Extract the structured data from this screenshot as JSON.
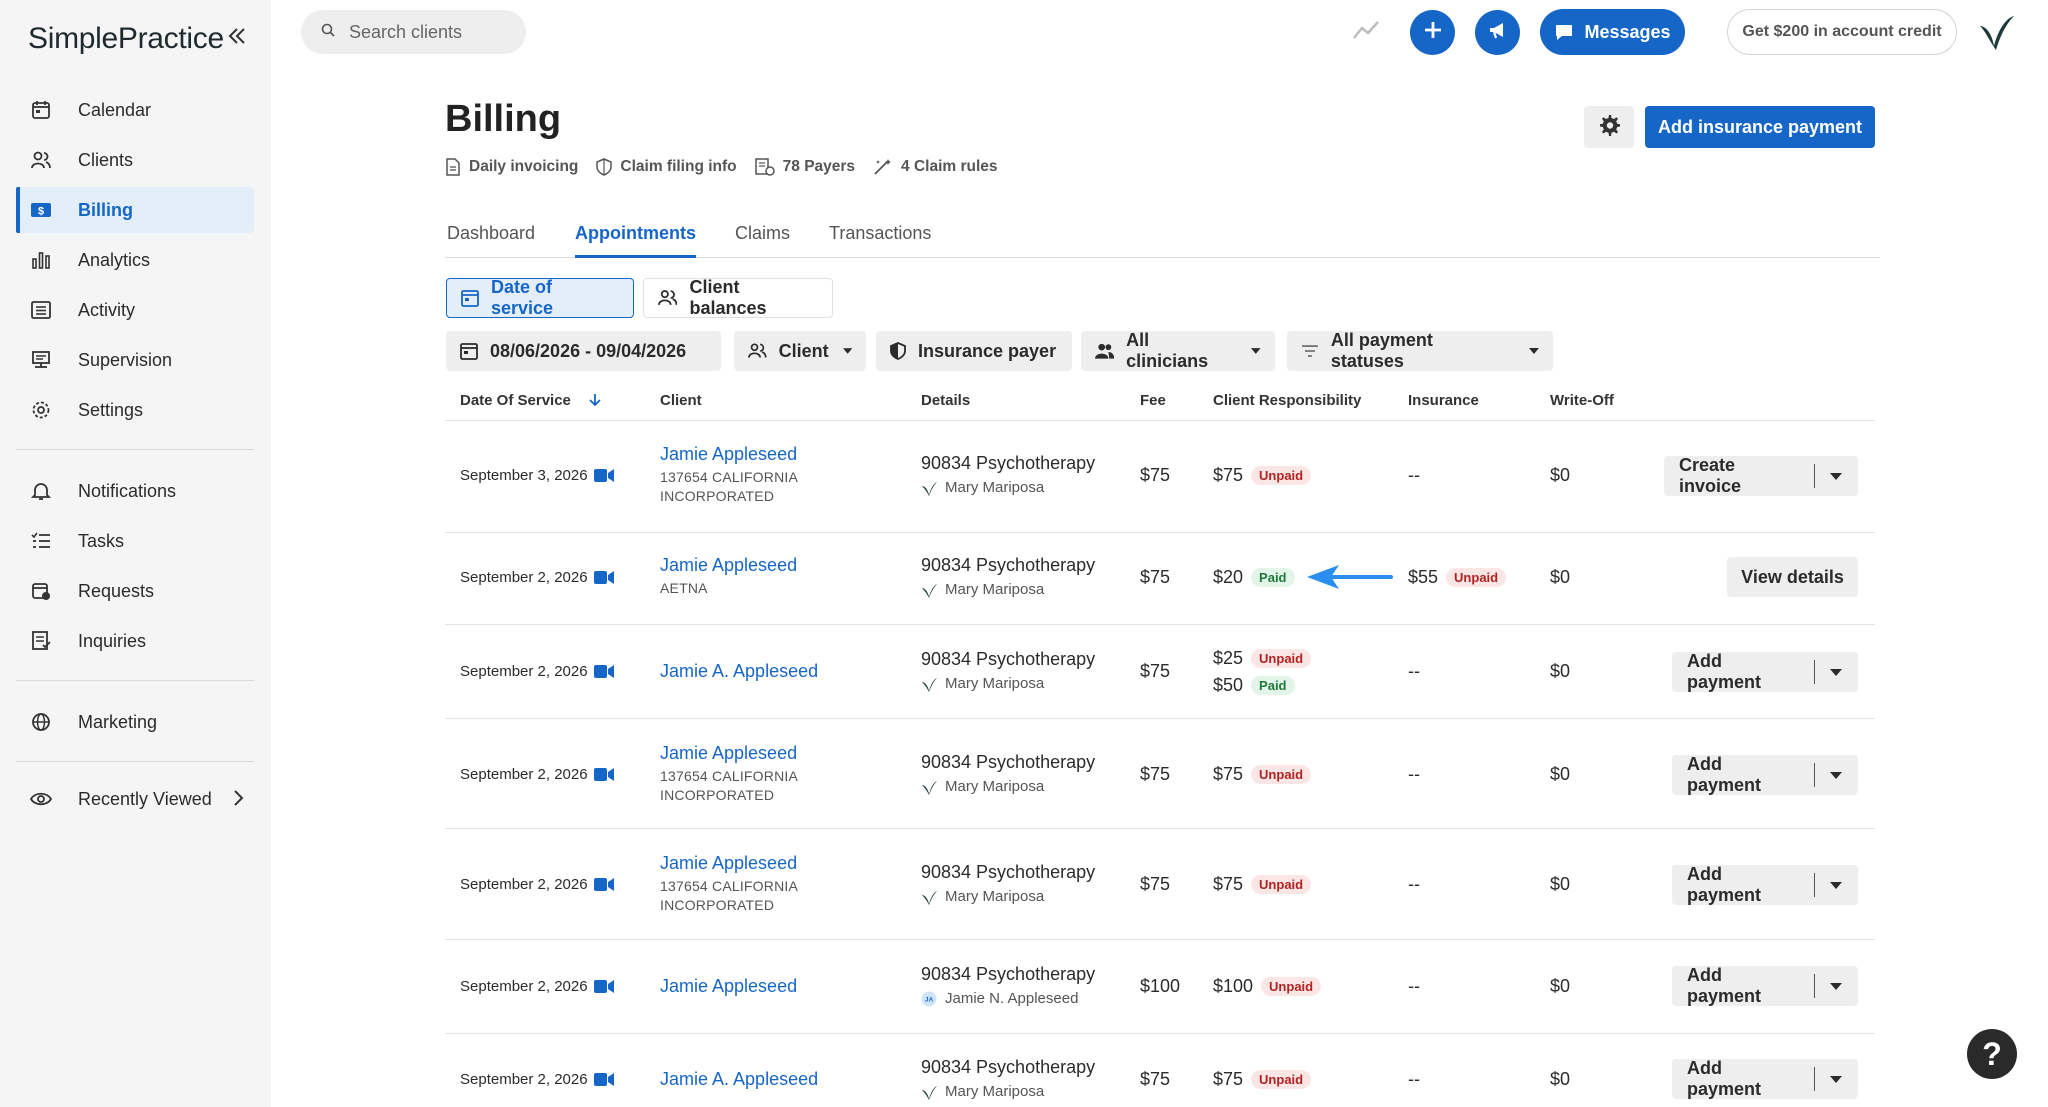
{
  "app": {
    "logo": "SimplePractice",
    "brand_color": "#1666c7"
  },
  "sidebar": {
    "items": [
      {
        "label": "Calendar",
        "icon": "calendar-icon"
      },
      {
        "label": "Clients",
        "icon": "clients-icon"
      },
      {
        "label": "Billing",
        "icon": "billing-icon",
        "active": true
      },
      {
        "label": "Analytics",
        "icon": "analytics-icon"
      },
      {
        "label": "Activity",
        "icon": "activity-icon"
      },
      {
        "label": "Supervision",
        "icon": "supervision-icon"
      },
      {
        "label": "Settings",
        "icon": "settings-icon"
      },
      {
        "label": "Notifications",
        "icon": "bell-icon"
      },
      {
        "label": "Tasks",
        "icon": "tasks-icon"
      },
      {
        "label": "Requests",
        "icon": "requests-icon"
      },
      {
        "label": "Inquiries",
        "icon": "inquiries-icon"
      },
      {
        "label": "Marketing",
        "icon": "globe-icon"
      },
      {
        "label": "Recently Viewed",
        "icon": "eye-icon"
      }
    ]
  },
  "topbar": {
    "search_placeholder": "Search clients",
    "messages_label": "Messages",
    "credit_label": "Get $200 in account credit"
  },
  "header": {
    "title": "Billing",
    "sub_links": [
      "Daily invoicing",
      "Claim filing info",
      "78 Payers",
      "4 Claim rules"
    ],
    "primary_button": "Add insurance payment"
  },
  "tabs": [
    "Dashboard",
    "Appointments",
    "Claims",
    "Transactions"
  ],
  "view_toggle": [
    "Date of service",
    "Client balances"
  ],
  "filters": {
    "date_range": "08/06/2026 - 09/04/2026",
    "client": "Client",
    "insurance": "Insurance payer",
    "clinicians": "All clinicians",
    "statuses": "All payment statuses"
  },
  "table": {
    "headers": [
      "Date Of Service",
      "Client",
      "Details",
      "Fee",
      "Client Responsibility",
      "Insurance",
      "Write-Off"
    ],
    "rows": [
      {
        "date": "September 3, 2026",
        "client": "Jamie Appleseed",
        "client_sub1": "137654 CALIFORNIA",
        "client_sub2": "INCORPORATED",
        "service": "90834 Psychotherapy",
        "clinician": "Mary Mariposa",
        "fee": "$75",
        "resp1": "$75",
        "resp1_status": "Unpaid",
        "resp2": "",
        "resp2_status": "",
        "insurance": "--",
        "insurance_status": "",
        "writeoff": "$0",
        "action": "Create invoice"
      },
      {
        "date": "September 2, 2026",
        "client": "Jamie Appleseed",
        "client_sub1": "AETNA",
        "client_sub2": "",
        "service": "90834 Psychotherapy",
        "clinician": "Mary Mariposa",
        "fee": "$75",
        "resp1": "$20",
        "resp1_status": "Paid",
        "resp2": "",
        "resp2_status": "",
        "insurance": "$55",
        "insurance_status": "Unpaid",
        "writeoff": "$0",
        "action": "View details"
      },
      {
        "date": "September 2, 2026",
        "client": "Jamie A. Appleseed",
        "client_sub1": "",
        "client_sub2": "",
        "service": "90834 Psychotherapy",
        "clinician": "Mary Mariposa",
        "fee": "$75",
        "resp1": "$25",
        "resp1_status": "Unpaid",
        "resp2": "$50",
        "resp2_status": "Paid",
        "insurance": "--",
        "insurance_status": "",
        "writeoff": "$0",
        "action": "Add payment"
      },
      {
        "date": "September 2, 2026",
        "client": "Jamie Appleseed",
        "client_sub1": "137654 CALIFORNIA",
        "client_sub2": "INCORPORATED",
        "service": "90834 Psychotherapy",
        "clinician": "Mary Mariposa",
        "fee": "$75",
        "resp1": "$75",
        "resp1_status": "Unpaid",
        "resp2": "",
        "resp2_status": "",
        "insurance": "--",
        "insurance_status": "",
        "writeoff": "$0",
        "action": "Add payment"
      },
      {
        "date": "September 2, 2026",
        "client": "Jamie Appleseed",
        "client_sub1": "137654 CALIFORNIA",
        "client_sub2": "INCORPORATED",
        "service": "90834 Psychotherapy",
        "clinician": "Mary Mariposa",
        "fee": "$75",
        "resp1": "$75",
        "resp1_status": "Unpaid",
        "resp2": "",
        "resp2_status": "",
        "insurance": "--",
        "insurance_status": "",
        "writeoff": "$0",
        "action": "Add payment"
      },
      {
        "date": "September 2, 2026",
        "client": "Jamie Appleseed",
        "client_sub1": "",
        "client_sub2": "",
        "service": "90834 Psychotherapy",
        "clinician": "Jamie N. Appleseed",
        "clinician_initials": "JA",
        "fee": "$100",
        "resp1": "$100",
        "resp1_status": "Unpaid",
        "resp2": "",
        "resp2_status": "",
        "insurance": "--",
        "insurance_status": "",
        "writeoff": "$0",
        "action": "Add payment"
      },
      {
        "date": "September 2, 2026",
        "client": "Jamie A. Appleseed",
        "client_sub1": "",
        "client_sub2": "",
        "service": "90834 Psychotherapy",
        "clinician": "Mary Mariposa",
        "fee": "$75",
        "resp1": "$75",
        "resp1_status": "Unpaid",
        "resp2": "",
        "resp2_status": "",
        "insurance": "--",
        "insurance_status": "",
        "writeoff": "$0",
        "action": "Add payment"
      }
    ]
  },
  "help_label": "?"
}
